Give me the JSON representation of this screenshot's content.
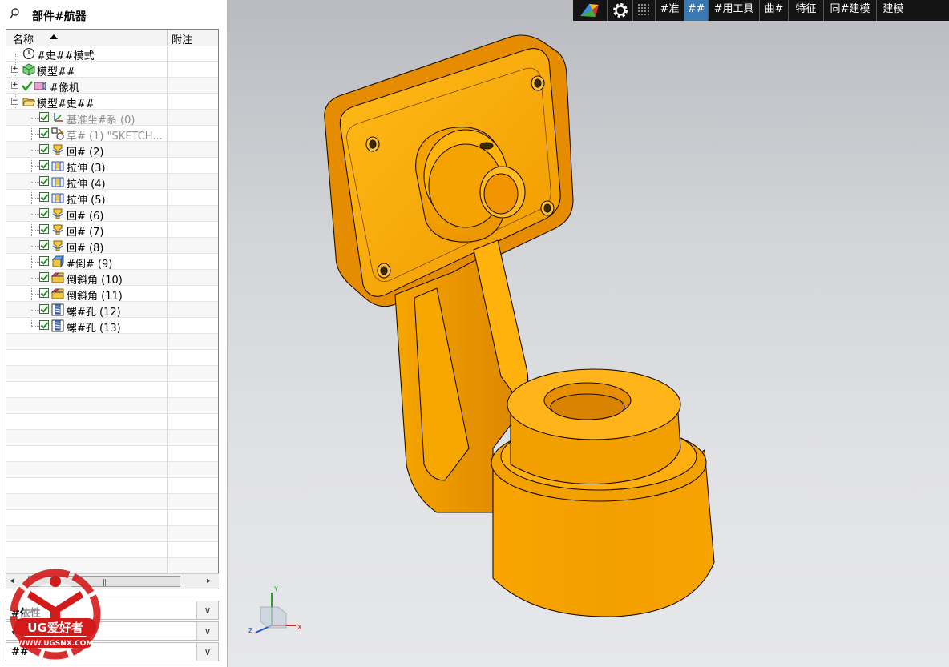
{
  "navigator": {
    "title": "部件#航器",
    "columns": {
      "name": "名称",
      "notes": "附注"
    },
    "tree": [
      {
        "label": "#史##模式"
      },
      {
        "label": "模型##"
      },
      {
        "label": "#像机"
      },
      {
        "label": "模型#史##"
      },
      {
        "label": "基准坐#系 (0)"
      },
      {
        "label": "草# (1) \"SKETCH..."
      },
      {
        "label": "回# (2)"
      },
      {
        "label": "拉伸 (3)"
      },
      {
        "label": "拉伸 (4)"
      },
      {
        "label": "拉伸 (5)"
      },
      {
        "label": "回# (6)"
      },
      {
        "label": "回# (7)"
      },
      {
        "label": "回# (8)"
      },
      {
        "label": "#倒# (9)"
      },
      {
        "label": "倒斜角 (10)"
      },
      {
        "label": "倒斜角 (11)"
      },
      {
        "label": "螺#孔 (12)"
      },
      {
        "label": "螺#孔 (13)"
      }
    ],
    "scroll_grip": "|||",
    "panels": [
      {
        "title": "#依性"
      },
      {
        "title": "##"
      },
      {
        "title": "##"
      }
    ]
  },
  "watermark": {
    "brand": "UG爱好者",
    "url": "WWW.UGSNX.COM"
  },
  "toolbar": {
    "items": [
      "#准",
      "##",
      "#用工具",
      "曲#",
      "特征",
      "同#建模",
      "建模"
    ]
  },
  "triad": {
    "x": "X",
    "y": "Y",
    "z": "Z"
  },
  "colors": {
    "part": "#f5a200",
    "selected_tab": "#3a78b4",
    "toolbar_bg": "#141414"
  }
}
